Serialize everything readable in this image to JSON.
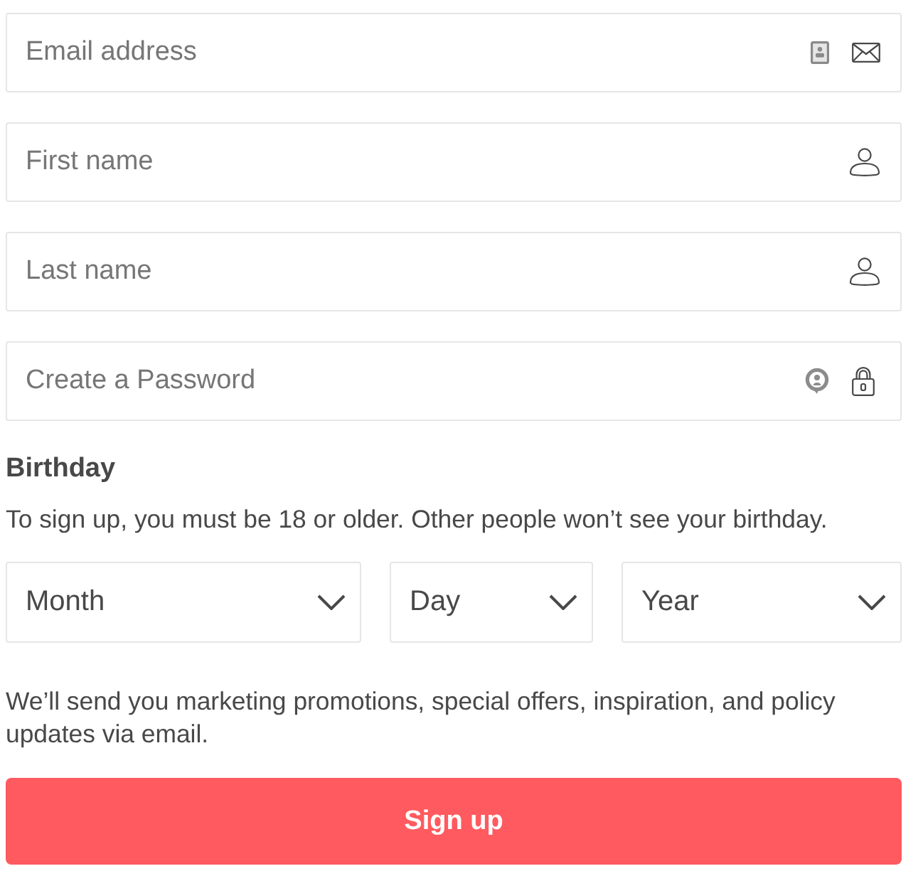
{
  "fields": [
    {
      "kind": "email",
      "placeholder": "Email address"
    },
    {
      "kind": "name",
      "placeholder": "First name"
    },
    {
      "kind": "name",
      "placeholder": "Last name"
    },
    {
      "kind": "password",
      "placeholder": "Create a Password"
    }
  ],
  "birthday": {
    "title": "Birthday",
    "note": "To sign up, you must be 18 or older. Other people won’t see your birthday.",
    "selects": [
      {
        "kind": "month",
        "placeholder": "Month"
      },
      {
        "kind": "day",
        "placeholder": "Day"
      },
      {
        "kind": "year",
        "placeholder": "Year"
      }
    ]
  },
  "marketing_note": "We’ll send you marketing promotions, special offers, inspiration, and policy updates via email.",
  "submit_button": "Sign up"
}
